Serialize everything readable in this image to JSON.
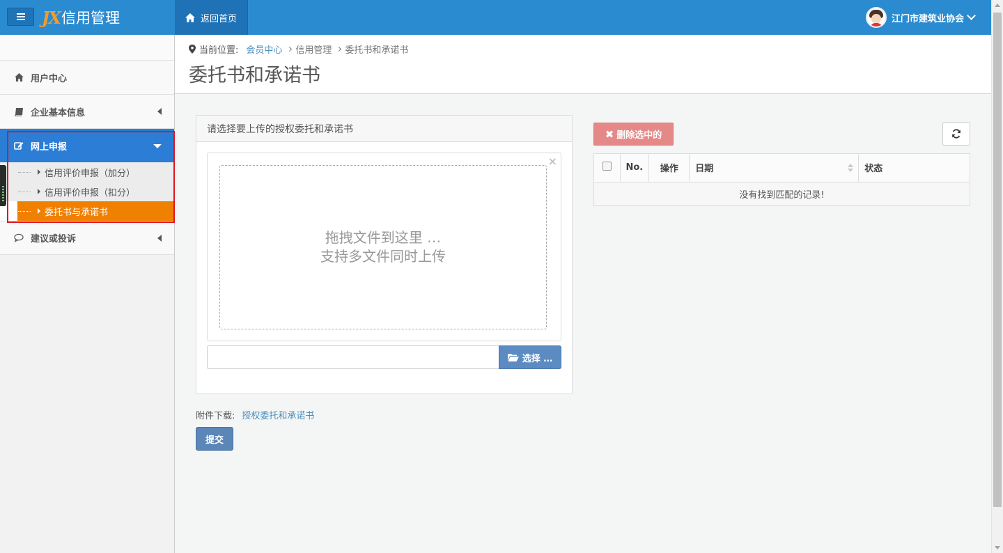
{
  "navbar": {
    "brand_logo": "JX",
    "brand_title": "信用管理",
    "home_label": "返回首页",
    "user_name": "江门市建筑业协会",
    "colors": {
      "bar": "#2b8bd0",
      "home": "#1f72b5",
      "logo": "#f39a2c"
    }
  },
  "sidebar": {
    "items": [
      {
        "label": "用户中心",
        "icon": "home-icon"
      },
      {
        "label": "企业基本信息",
        "icon": "book-icon"
      },
      {
        "label": "网上申报",
        "icon": "edit-icon",
        "active": true,
        "children": [
          {
            "label": "信用评价申报（加分）"
          },
          {
            "label": "信用评价申报（扣分）"
          },
          {
            "label": "委托书与承诺书",
            "current": true
          }
        ]
      },
      {
        "label": "建议或投诉",
        "icon": "comment-icon"
      }
    ],
    "colors": {
      "active": "#2b7dd6",
      "current": "#f08000",
      "highlight": "#e0151e"
    }
  },
  "breadcrumb": {
    "prefix": "当前位置:",
    "items": [
      "会员中心",
      "信用管理",
      "委托书和承诺书"
    ]
  },
  "page_title": "委托书和承诺书",
  "upload": {
    "panel_title": "请选择要上传的授权委托和承诺书",
    "close_symbol": "×",
    "drop_line1": "拖拽文件到这里 …",
    "drop_line2": "支持多文件同时上传",
    "caption_value": "",
    "browse_label": "选择 …"
  },
  "attachment": {
    "label": "附件下载:",
    "link_text": "授权委托和承诺书"
  },
  "submit_label": "提交",
  "toolbar": {
    "delete_label": "删除选中的",
    "delete_icon": "times-icon",
    "refresh_icon": "refresh-icon"
  },
  "table": {
    "columns": [
      "No.",
      "操作",
      "日期",
      "状态"
    ],
    "empty_message": "没有找到匹配的记录!"
  }
}
